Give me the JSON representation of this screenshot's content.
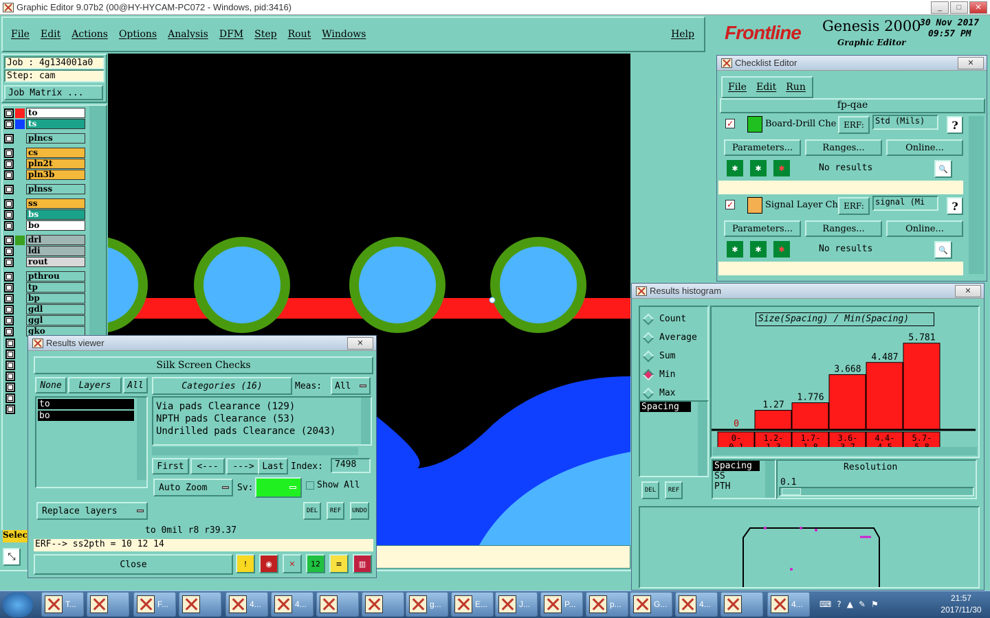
{
  "window": {
    "title": "Graphic Editor 9.07b2 (00@HY-HYCAM-PC072 - Windows, pid:3416)"
  },
  "menu": [
    "File",
    "Edit",
    "Actions",
    "Options",
    "Analysis",
    "DFM",
    "Step",
    "Rout",
    "Windows"
  ],
  "help_label": "Help",
  "brand": {
    "logo": "Frontline",
    "product": "Genesis 2000",
    "subtitle": "Graphic Editor",
    "date": "30 Nov 2017",
    "time": "09:57 PM"
  },
  "job": {
    "job_label": "Job : 4g134001a0",
    "step_label": "Step: cam",
    "matrix_button": "Job Matrix ..."
  },
  "layers": [
    {
      "name": "to",
      "color": "#ff2020",
      "bg": "#ffffff"
    },
    {
      "name": "ts",
      "color": "#1040ff",
      "bg": "#1aa38a"
    },
    {
      "name": "plncs",
      "color": "",
      "bg": "#7fcfbe"
    },
    {
      "name": "cs",
      "color": "",
      "bg": "#f4b83a"
    },
    {
      "name": "pln2t",
      "color": "",
      "bg": "#f4b83a"
    },
    {
      "name": "pln3b",
      "color": "",
      "bg": "#f4b83a"
    },
    {
      "name": "plnss",
      "color": "",
      "bg": "#7fcfbe"
    },
    {
      "name": "ss",
      "color": "",
      "bg": "#f4b83a"
    },
    {
      "name": "bs",
      "color": "",
      "bg": "#1aa38a"
    },
    {
      "name": "bo",
      "color": "",
      "bg": "#ffffff"
    },
    {
      "name": "drl",
      "color": "#3aa020",
      "bg": "#9fb6b4"
    },
    {
      "name": "ldi",
      "color": "",
      "bg": "#9fb6b4"
    },
    {
      "name": "rout",
      "color": "",
      "bg": "#d8d8d8"
    },
    {
      "name": "pthrou",
      "color": "",
      "bg": "#7fcfbe"
    },
    {
      "name": "tp",
      "color": "",
      "bg": "#7fcfbe"
    },
    {
      "name": "bp",
      "color": "",
      "bg": "#7fcfbe"
    },
    {
      "name": "gdl",
      "color": "",
      "bg": "#7fcfbe"
    },
    {
      "name": "ggl",
      "color": "",
      "bg": "#7fcfbe"
    },
    {
      "name": "gko",
      "color": "",
      "bg": "#7fcfbe"
    }
  ],
  "select_label": "Selec",
  "checklist": {
    "title": "Checklist Editor",
    "menu": [
      "File",
      "Edit",
      "Run"
    ],
    "name": "fp-qae",
    "checks": [
      {
        "name": "Board-Drill Che",
        "erf": "ERF:",
        "param": "Std (Mils)",
        "results": "No results"
      },
      {
        "name": "Signal Layer Ch",
        "erf": "ERF:",
        "param": "signal (Mi",
        "results": "No results"
      }
    ],
    "buttons": [
      "Parameters...",
      "Ranges...",
      "Online..."
    ],
    "help": "?"
  },
  "results_viewer": {
    "title": "Results viewer",
    "heading": "Silk Screen Checks",
    "none_label": "None",
    "layers_label": "Layers",
    "all_label": "All",
    "categories_label": "Categories (16)",
    "meas_label": "Meas:",
    "meas_value": "All",
    "layer_items": [
      "to",
      "bo"
    ],
    "categories": [
      "Via pads Clearance (129)",
      "NPTH pads Clearance (53)",
      "Undrilled pads Clearance (2043)"
    ],
    "nav": {
      "first": "First",
      "prev": "<---",
      "next": "--->",
      "last": "Last",
      "index_label": "Index:",
      "index_value": "7498"
    },
    "auto_zoom": "Auto Zoom",
    "sv_label": "Sv:",
    "show_all": "Show All",
    "small_buttons": [
      "DEL",
      "REF",
      "UNDO"
    ],
    "replace_layers": "Replace layers",
    "status": "to 0mil  r8  r39.37",
    "erf_line": "ERF--> ss2pth = 10 12 14",
    "close_label": "Close"
  },
  "histogram": {
    "title": "Results histogram",
    "modes": [
      "Count",
      "Average",
      "Sum",
      "Min",
      "Max"
    ],
    "selected_mode": "Min",
    "list_item": "Spacing",
    "chart_title": "Size(Spacing) / Min(Spacing)",
    "resolution_label": "Resolution",
    "resolution_value": "0.1",
    "lower_list": [
      "Spacing",
      "SS",
      "PTH"
    ],
    "small_buttons": [
      "DEL",
      "REF"
    ]
  },
  "chart_data": {
    "type": "bar",
    "title": "Size(Spacing) / Min(Spacing)",
    "categories": [
      "0-\n0.1",
      "1.2-\n1.3",
      "1.7-\n1.8",
      "3.6-\n3.7",
      "4.4-\n4.5",
      "5.7-\n5.8"
    ],
    "category_labels": [
      [
        "0-",
        "0.1"
      ],
      [
        "1.2-",
        "1.3"
      ],
      [
        "1.7-",
        "1.8"
      ],
      [
        "3.6-",
        "3.7"
      ],
      [
        "4.4-",
        "4.5"
      ],
      [
        "5.7-",
        "5.8"
      ]
    ],
    "values": [
      0,
      1.27,
      1.776,
      3.668,
      4.487,
      5.781
    ],
    "value_labels": [
      "0",
      "1.27",
      "1.776",
      "3.668",
      "4.487",
      "5.781"
    ],
    "bar_color": "#ff1a1a",
    "ylim": [
      0,
      6
    ]
  },
  "taskbar": {
    "items": [
      "T...",
      "",
      "F...",
      "",
      "4...",
      "4...",
      "",
      "",
      "g...",
      "E...",
      "J...",
      "P...",
      "p...",
      "G...",
      "4...",
      "",
      "4..."
    ],
    "clock_time": "21:57",
    "clock_date": "2017/11/30"
  },
  "colors": {
    "panel": "#7fcfbe",
    "canvas": "#000000",
    "trace": "#ff1a1a",
    "pad_ring": "#4a9a10",
    "pad_fill": "#4db4ff",
    "copper_blue": "#1040ff"
  }
}
